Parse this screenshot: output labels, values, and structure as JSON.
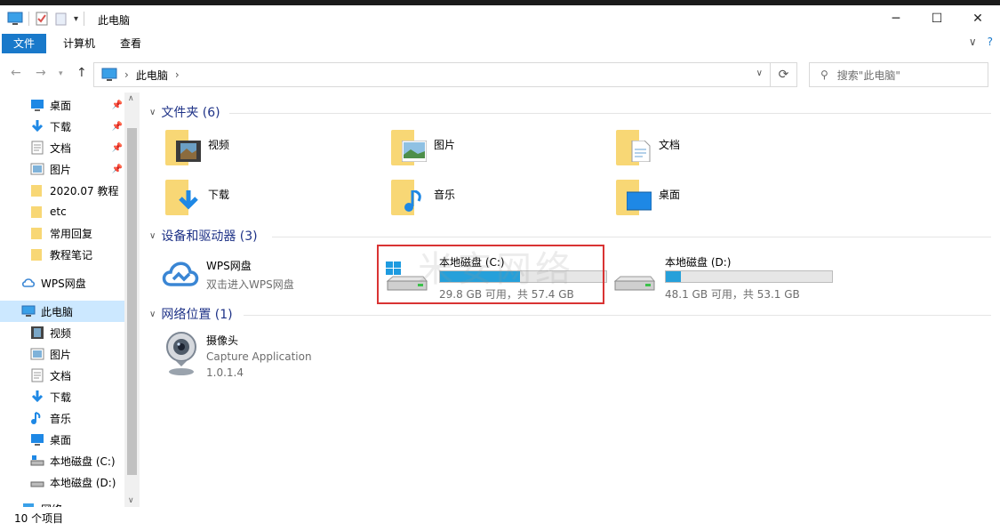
{
  "window": {
    "title": "此电脑"
  },
  "ribbon": {
    "tabs": [
      "文件",
      "计算机",
      "查看"
    ],
    "right_chevron": "∨",
    "help": "?"
  },
  "address": {
    "crumb": "此电脑",
    "search_placeholder": "搜索\"此电脑\""
  },
  "sidebar": {
    "items": [
      {
        "label": "桌面",
        "icon": "desktop-icon",
        "pinned": true
      },
      {
        "label": "下载",
        "icon": "download-icon",
        "pinned": true
      },
      {
        "label": "文档",
        "icon": "document-icon",
        "pinned": true
      },
      {
        "label": "图片",
        "icon": "pictures-icon",
        "pinned": true
      },
      {
        "label": "2020.07 教程",
        "icon": "folder-icon"
      },
      {
        "label": "etc",
        "icon": "folder-icon"
      },
      {
        "label": "常用回复",
        "icon": "folder-icon"
      },
      {
        "label": "教程笔记",
        "icon": "folder-icon"
      },
      {
        "label": "WPS网盘",
        "icon": "wps-cloud-icon"
      },
      {
        "label": "此电脑",
        "icon": "this-pc-icon",
        "selected": true
      },
      {
        "label": "视频",
        "icon": "video-icon"
      },
      {
        "label": "图片",
        "icon": "pictures-icon"
      },
      {
        "label": "文档",
        "icon": "document-icon"
      },
      {
        "label": "下载",
        "icon": "download-icon"
      },
      {
        "label": "音乐",
        "icon": "music-icon"
      },
      {
        "label": "桌面",
        "icon": "desktop-icon"
      },
      {
        "label": "本地磁盘 (C:)",
        "icon": "drive-c-icon"
      },
      {
        "label": "本地磁盘 (D:)",
        "icon": "drive-d-icon"
      },
      {
        "label": "网络",
        "icon": "network-icon"
      }
    ]
  },
  "groups": {
    "folders": {
      "title": "文件夹 (6)",
      "items": [
        "视频",
        "图片",
        "文档",
        "下载",
        "音乐",
        "桌面"
      ]
    },
    "devices": {
      "title": "设备和驱动器 (3)",
      "wps": {
        "name": "WPS网盘",
        "sub": "双击进入WPS网盘"
      },
      "drives": [
        {
          "name": "本地磁盘 (C:)",
          "info": "29.8 GB 可用，共 57.4 GB",
          "used_fraction": 0.48
        },
        {
          "name": "本地磁盘 (D:)",
          "info": "48.1 GB 可用，共 53.1 GB",
          "used_fraction": 0.09
        }
      ]
    },
    "network": {
      "title": "网络位置 (1)",
      "item": {
        "name": "摄像头",
        "line1": "Capture Application",
        "line2": "1.0.1.4"
      }
    }
  },
  "watermark": "米安网络",
  "status": {
    "count": "10 个项目"
  },
  "colors": {
    "accent": "#1979ca",
    "bar_fill": "#26a0da",
    "highlight_border": "#d93333",
    "group_title": "#1e3287"
  }
}
